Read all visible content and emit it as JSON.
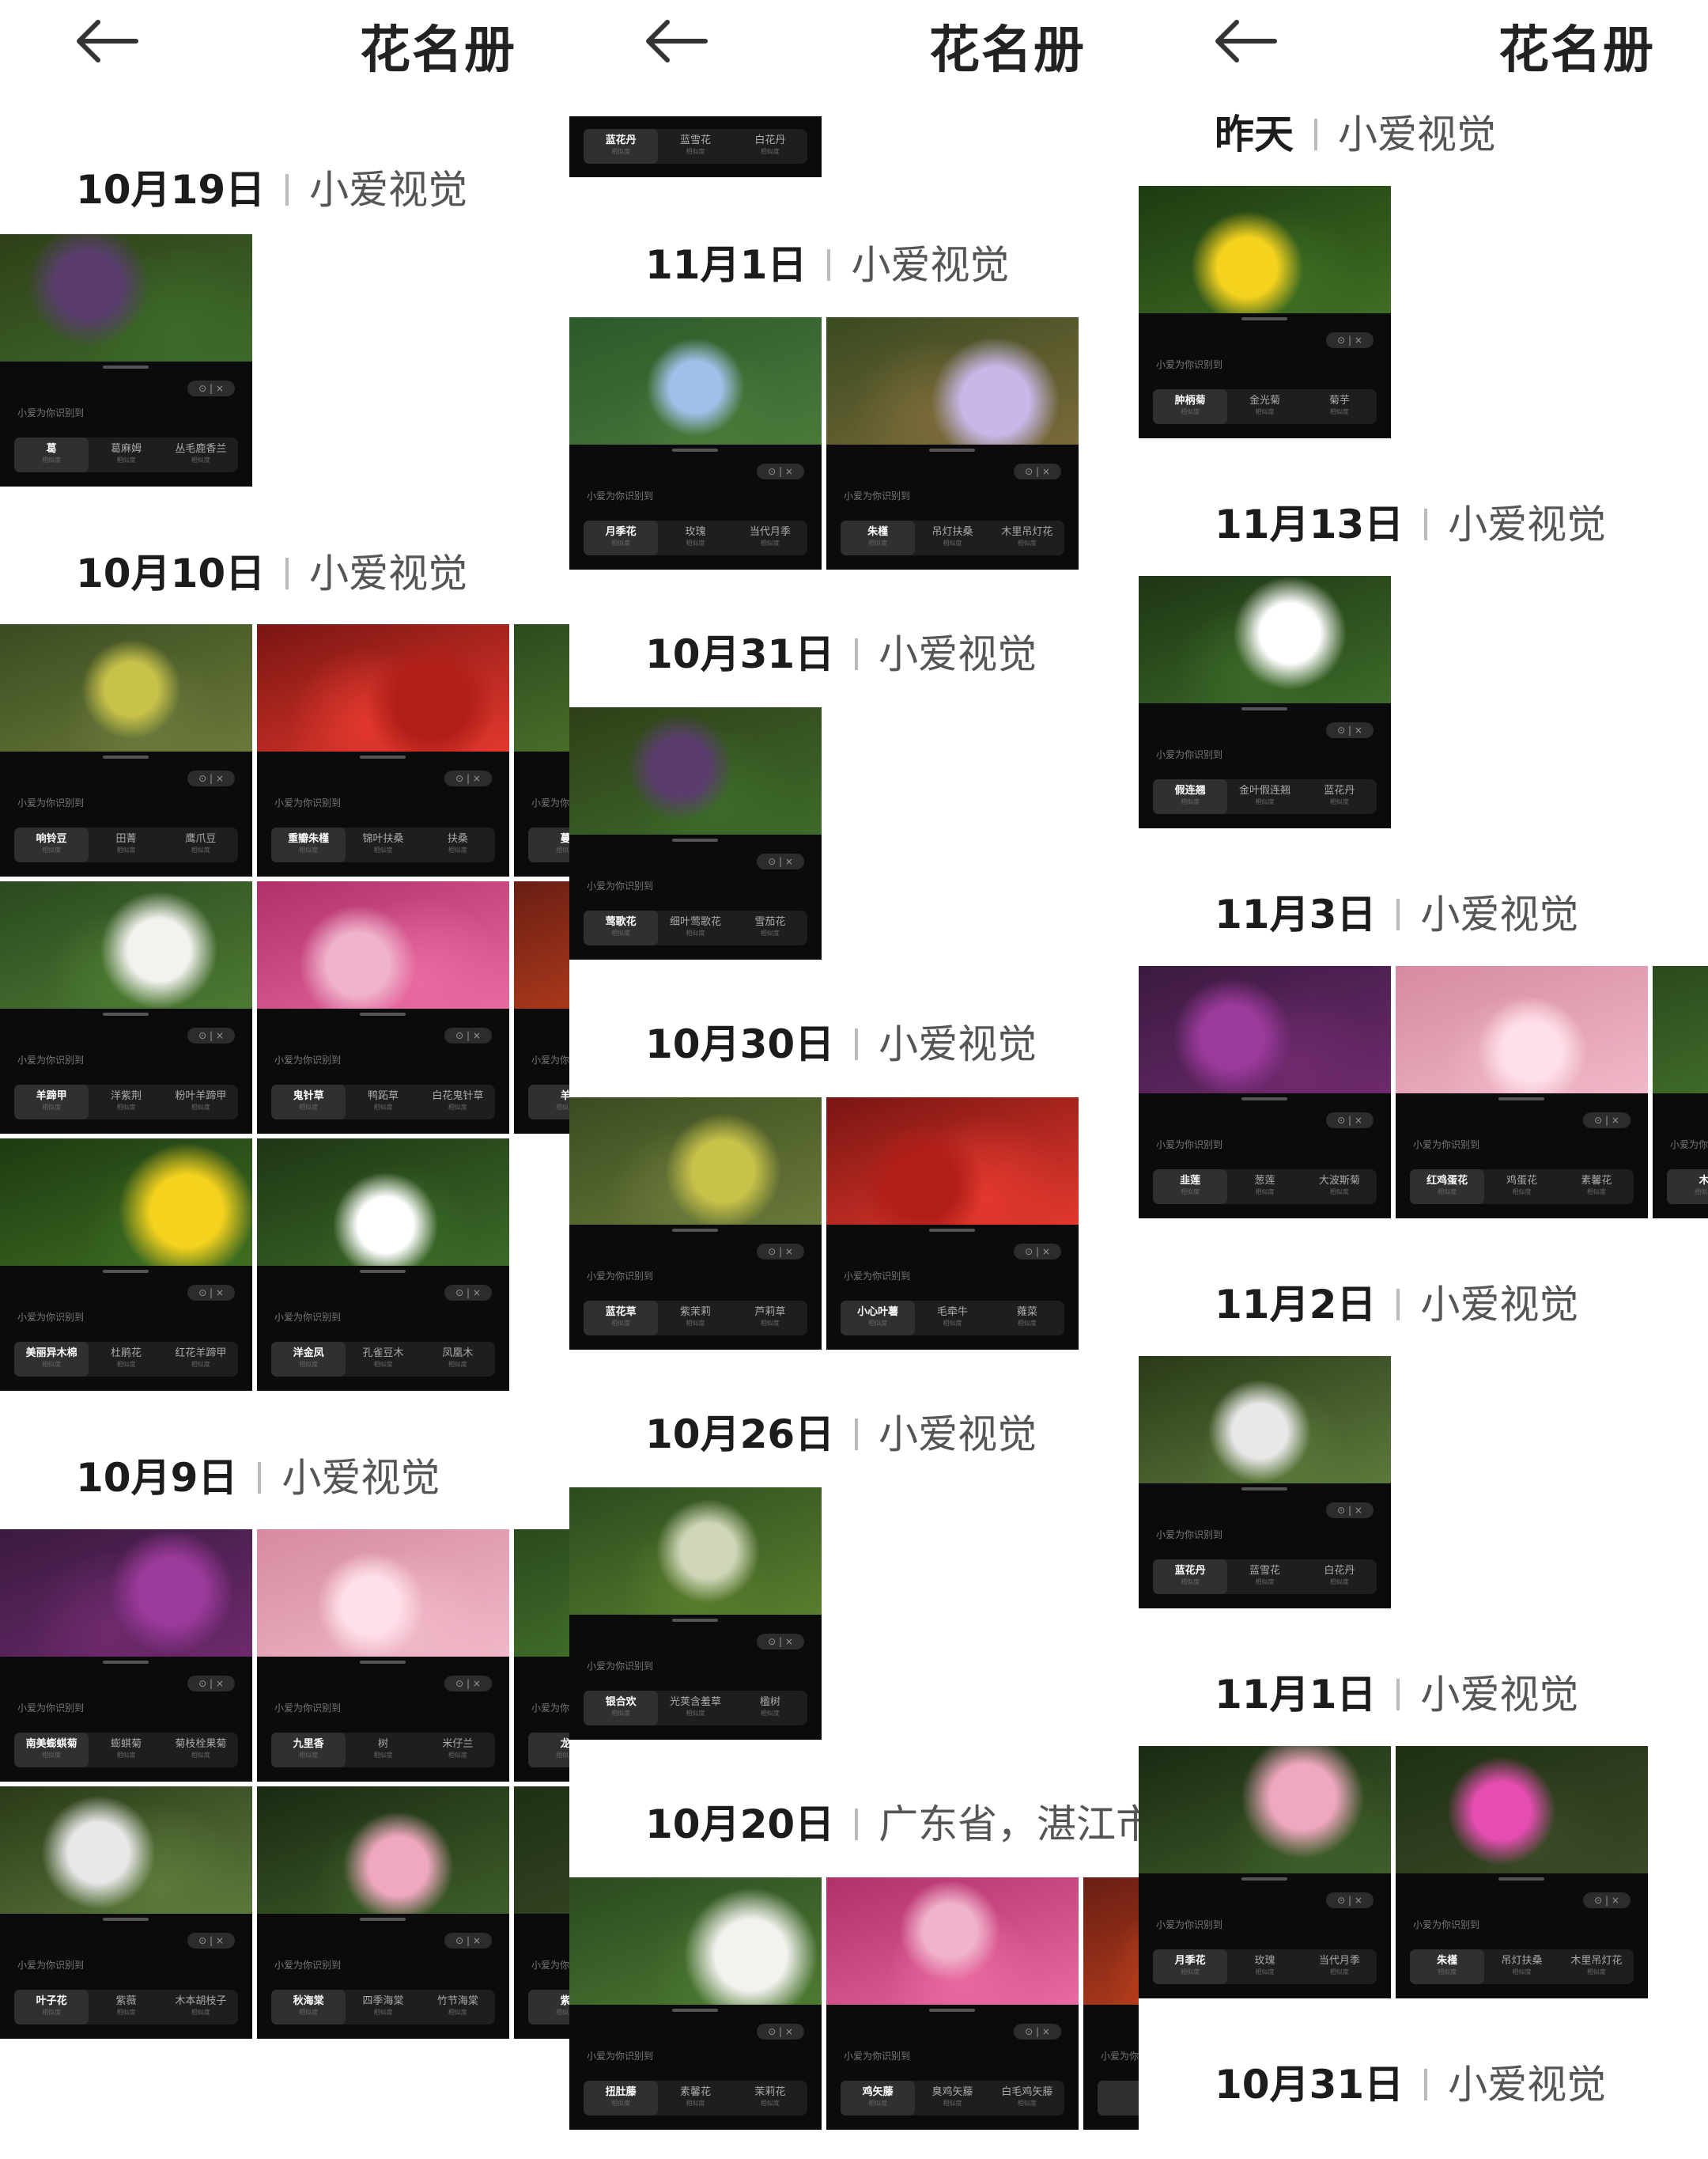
{
  "page_title": "花名册",
  "source_label": "小爱视觉",
  "hint_text": "小爱为你识别到",
  "control_text": "⊙ | ×",
  "similarity_label": "相似度",
  "colors": {
    "background": "#ffffff",
    "card": "#0b0b0b",
    "chip": "#1e1e1e"
  },
  "icons": {
    "back": "back-arrow-icon"
  },
  "panels": [
    {
      "sections": [
        {
          "date": "10月19日",
          "source": "小爱视觉",
          "cards": [
            {
              "chips": [
                "葛",
                "葛麻姆",
                "丛毛鹿香兰"
              ]
            }
          ]
        },
        {
          "date": "10月10日",
          "source": "小爱视觉",
          "cards": [
            {
              "chips": [
                "响铃豆",
                "田菁",
                "鹰爪豆"
              ]
            },
            {
              "chips": [
                "重瓣朱槿",
                "锦叶扶桑",
                "扶桑"
              ]
            },
            {
              "chips": [
                "蔓",
                "",
                ""
              ]
            },
            {
              "chips": [
                "羊蹄甲",
                "洋紫荆",
                "粉叶羊蹄甲"
              ]
            },
            {
              "chips": [
                "鬼针草",
                "鸭跖草",
                "白花鬼针草"
              ]
            },
            {
              "chips": [
                "羊",
                "",
                ""
              ]
            },
            {
              "chips": [
                "美丽异木棉",
                "杜鹃花",
                "红花羊蹄甲"
              ]
            },
            {
              "chips": [
                "洋金凤",
                "孔雀豆木",
                "凤凰木"
              ]
            }
          ]
        },
        {
          "date": "10月9日",
          "source": "小爱视觉",
          "cards": [
            {
              "chips": [
                "南美蟛蜞菊",
                "蟛蜞菊",
                "菊枝栓果菊"
              ]
            },
            {
              "chips": [
                "九里香",
                "树",
                "米仔兰"
              ]
            },
            {
              "chips": [
                "龙",
                "",
                ""
              ]
            },
            {
              "chips": [
                "叶子花",
                "紫薇",
                "木本胡枝子"
              ]
            },
            {
              "chips": [
                "秋海棠",
                "四季海棠",
                "竹节海棠"
              ]
            },
            {
              "chips": [
                "紫",
                "",
                ""
              ]
            }
          ]
        }
      ]
    },
    {
      "top_strip": {
        "chips": [
          "蓝花丹",
          "蓝雪花",
          "白花丹"
        ]
      },
      "sections": [
        {
          "date": "11月1日",
          "source": "小爱视觉",
          "cards": [
            {
              "chips": [
                "月季花",
                "玫瑰",
                "当代月季"
              ]
            },
            {
              "chips": [
                "朱槿",
                "吊灯扶桑",
                "木里吊灯花"
              ]
            }
          ]
        },
        {
          "date": "10月31日",
          "source": "小爱视觉",
          "cards": [
            {
              "chips": [
                "莺歌花",
                "细叶莺歌花",
                "雪茄花"
              ]
            }
          ]
        },
        {
          "date": "10月30日",
          "source": "小爱视觉",
          "cards": [
            {
              "chips": [
                "蓝花草",
                "紫茉莉",
                "芦莉草"
              ]
            },
            {
              "chips": [
                "小心叶薯",
                "毛牵牛",
                "蕹菜"
              ]
            }
          ]
        },
        {
          "date": "10月26日",
          "source": "小爱视觉",
          "cards": [
            {
              "chips": [
                "银合欢",
                "光荚含羞草",
                "楹树"
              ]
            }
          ]
        },
        {
          "date": "10月20日",
          "source": "广东省，湛江市",
          "cards": [
            {
              "chips": [
                "扭肚藤",
                "素馨花",
                "茉莉花"
              ]
            },
            {
              "chips": [
                "鸡矢藤",
                "臭鸡矢藤",
                "白毛鸡矢藤"
              ]
            },
            {
              "chips": [
                "",
                "",
                ""
              ]
            }
          ]
        }
      ]
    },
    {
      "sections": [
        {
          "date": "昨天",
          "source": "小爱视觉",
          "cards": [
            {
              "chips": [
                "肿柄菊",
                "金光菊",
                "菊芋"
              ]
            }
          ]
        },
        {
          "date": "11月13日",
          "source": "小爱视觉",
          "cards": [
            {
              "chips": [
                "假连翘",
                "金叶假连翘",
                "蓝花丹"
              ]
            }
          ]
        },
        {
          "date": "11月3日",
          "source": "小爱视觉",
          "cards": [
            {
              "chips": [
                "韭莲",
                "葱莲",
                "大波斯菊"
              ]
            },
            {
              "chips": [
                "红鸡蛋花",
                "鸡蛋花",
                "素馨花"
              ]
            },
            {
              "chips": [
                "木",
                "",
                ""
              ]
            }
          ]
        },
        {
          "date": "11月2日",
          "source": "小爱视觉",
          "cards": [
            {
              "chips": [
                "蓝花丹",
                "蓝雪花",
                "白花丹"
              ]
            }
          ]
        },
        {
          "date": "11月1日",
          "source": "小爱视觉",
          "cards": [
            {
              "chips": [
                "月季花",
                "玫瑰",
                "当代月季"
              ]
            },
            {
              "chips": [
                "朱槿",
                "吊灯扶桑",
                "木里吊灯花"
              ]
            }
          ]
        },
        {
          "date": "10月31日",
          "source": "小爱视觉",
          "cards": []
        }
      ]
    }
  ]
}
